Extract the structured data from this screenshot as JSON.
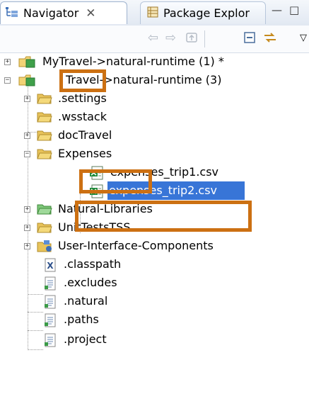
{
  "tabs": [
    {
      "label": "Navigator",
      "icon": "navigator-icon",
      "close": "✕"
    },
    {
      "label": "Package Explor",
      "icon": "package-explorer-icon"
    }
  ],
  "view_controls": {
    "minimize": "—",
    "maximize": "□"
  },
  "toolbar": {
    "icons": [
      "back-arrow-icon",
      "forward-arrow-icon",
      "go-up-icon",
      "collapse-all-icon",
      "link-with-editor-icon",
      "view-menu-icon"
    ]
  },
  "tree": {
    "items": [
      {
        "label": "MyTravel->natural-runtime (1) *",
        "icon": "project-icon",
        "state": "collapsed"
      },
      {
        "label": "Travel->natural-runtime (3)",
        "icon": "project-icon",
        "state": "expanded"
      },
      {
        "label": ".settings",
        "icon": "folder-icon",
        "state": "collapsed"
      },
      {
        "label": ".wsstack",
        "icon": "folder-icon",
        "state": "leaf"
      },
      {
        "label": "docTravel",
        "icon": "folder-icon",
        "state": "collapsed"
      },
      {
        "label": "Expenses",
        "icon": "folder-icon",
        "state": "expanded"
      },
      {
        "label": "expenses_trip1.csv",
        "icon": "csv-file-icon",
        "state": "leaf"
      },
      {
        "label": "expenses_trip2.csv",
        "icon": "csv-file-icon",
        "state": "leaf",
        "selected": true
      },
      {
        "label": "Natural-Libraries",
        "icon": "folder-icon",
        "state": "collapsed"
      },
      {
        "label": "UnitTestsTSS",
        "icon": "folder-icon",
        "state": "collapsed"
      },
      {
        "label": "User-Interface-Components",
        "icon": "ui-components-folder-icon",
        "state": "collapsed"
      },
      {
        "label": ".classpath",
        "icon": "xml-file-icon",
        "state": "leaf"
      },
      {
        "label": ".excludes",
        "icon": "text-file-icon",
        "state": "leaf"
      },
      {
        "label": ".natural",
        "icon": "text-file-icon",
        "state": "leaf"
      },
      {
        "label": ".paths",
        "icon": "text-file-icon",
        "state": "leaf"
      },
      {
        "label": ".project",
        "icon": "text-file-icon",
        "state": "leaf"
      }
    ]
  },
  "colors": {
    "highlight_box": "#cc7012",
    "selection": "#3875d7",
    "folder": "#e8c35a"
  }
}
